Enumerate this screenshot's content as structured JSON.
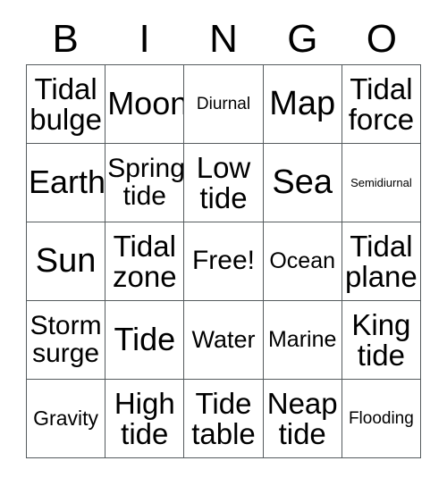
{
  "card": {
    "title_letters": [
      "B",
      "I",
      "N",
      "G",
      "O"
    ],
    "free_space_label": "Free!",
    "colors": {
      "background": "#ffffff",
      "border": "#555b5e",
      "text": "#000000"
    },
    "rows": [
      [
        {
          "label": "Tidal bulge",
          "size": "xl"
        },
        {
          "label": "Moon",
          "size": "xxl"
        },
        {
          "label": "Diurnal",
          "size": "sm"
        },
        {
          "label": "Map",
          "size": "xxxl"
        },
        {
          "label": "Tidal force",
          "size": "xl"
        }
      ],
      [
        {
          "label": "Earth",
          "size": "xxl"
        },
        {
          "label": "Spring tide",
          "size": "lg2"
        },
        {
          "label": "Low tide",
          "size": "xl"
        },
        {
          "label": "Sea",
          "size": "xxxl"
        },
        {
          "label": "Semidiurnal",
          "size": "xs"
        }
      ],
      [
        {
          "label": "Sun",
          "size": "xxxl"
        },
        {
          "label": "Tidal zone",
          "size": "xl"
        },
        {
          "label": "Free!",
          "size": "lg2"
        },
        {
          "label": "Ocean",
          "size": "md2"
        },
        {
          "label": "Tidal plane",
          "size": "xl"
        }
      ],
      [
        {
          "label": "Storm surge",
          "size": "lg2"
        },
        {
          "label": "Tide",
          "size": "xxl"
        },
        {
          "label": "Water",
          "size": "lg"
        },
        {
          "label": "Marine",
          "size": "md2"
        },
        {
          "label": "King tide",
          "size": "xl"
        }
      ],
      [
        {
          "label": "Gravity",
          "size": "md"
        },
        {
          "label": "High tide",
          "size": "xl"
        },
        {
          "label": "Tide table",
          "size": "xl"
        },
        {
          "label": "Neap tide",
          "size": "xl"
        },
        {
          "label": "Flooding",
          "size": "sm"
        }
      ]
    ]
  }
}
